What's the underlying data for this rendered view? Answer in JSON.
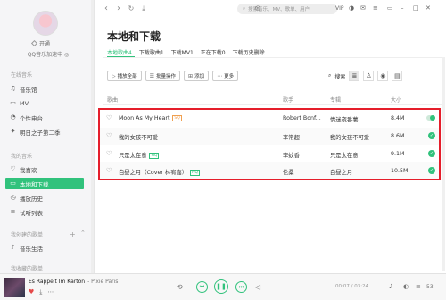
{
  "sidebar": {
    "vip_label": "开通",
    "username": "QQ音乐加速中 ◎",
    "sections": {
      "online": "在线音乐",
      "mine": "我的音乐",
      "created": "我创建的歌单",
      "collected": "我收藏的歌单"
    },
    "items": [
      {
        "label": "音乐馆",
        "icon": "music-icon"
      },
      {
        "label": "MV",
        "icon": "video-icon"
      },
      {
        "label": "个性电台",
        "icon": "radio-icon"
      },
      {
        "label": "明日之子第二季",
        "icon": "star-icon"
      },
      {
        "label": "我喜欢",
        "icon": "heart-icon"
      },
      {
        "label": "本地和下载",
        "icon": "monitor-icon",
        "active": true
      },
      {
        "label": "播放历史",
        "icon": "history-icon"
      },
      {
        "label": "试听列表",
        "icon": "list-icon"
      },
      {
        "label": "音乐生活",
        "icon": "life-icon"
      }
    ]
  },
  "topbar": {
    "search_placeholder": "搜索音乐、MV、歌单、用户",
    "vip": "VIP"
  },
  "main": {
    "title": "本地和下载",
    "tabs": [
      "本地歌曲4",
      "下载歌曲1",
      "下载MV1",
      "正在下载0",
      "下载历史删除"
    ],
    "toolbar": {
      "play_all": "播放全部",
      "batch": "批量操作",
      "add": "添加",
      "more": "更多",
      "search": "搜索"
    },
    "columns": {
      "title": "歌曲",
      "artist": "歌手",
      "album": "专辑",
      "size": "大小"
    },
    "rows": [
      {
        "title": "Moon As My Heart",
        "badge": "SQ",
        "artist": "Robert Bonf...",
        "album": "情迷夜番薯",
        "size": "8.4M",
        "status": "toggle"
      },
      {
        "title": "我的女孩不可爱",
        "badge": "",
        "artist": "李常超",
        "album": "我的女孩不可爱",
        "size": "8.6M",
        "status": "check"
      },
      {
        "title": "只是太在意",
        "badge": "HQ",
        "artist": "李蚊香",
        "album": "只是太在意",
        "size": "9.1M",
        "status": "check"
      },
      {
        "title": "白昼之月（Cover 林宥嘉）",
        "badge": "HQ",
        "artist": "伦桑",
        "album": "白昼之月",
        "size": "10.5M",
        "status": "check"
      }
    ]
  },
  "player": {
    "song": "Es Rappelt Im Karton",
    "artist": "- Pixie Paris",
    "time": "00:07 / 03:24",
    "count": "53"
  },
  "colors": {
    "accent": "#31c27c",
    "highlight": "#e51e2b"
  }
}
